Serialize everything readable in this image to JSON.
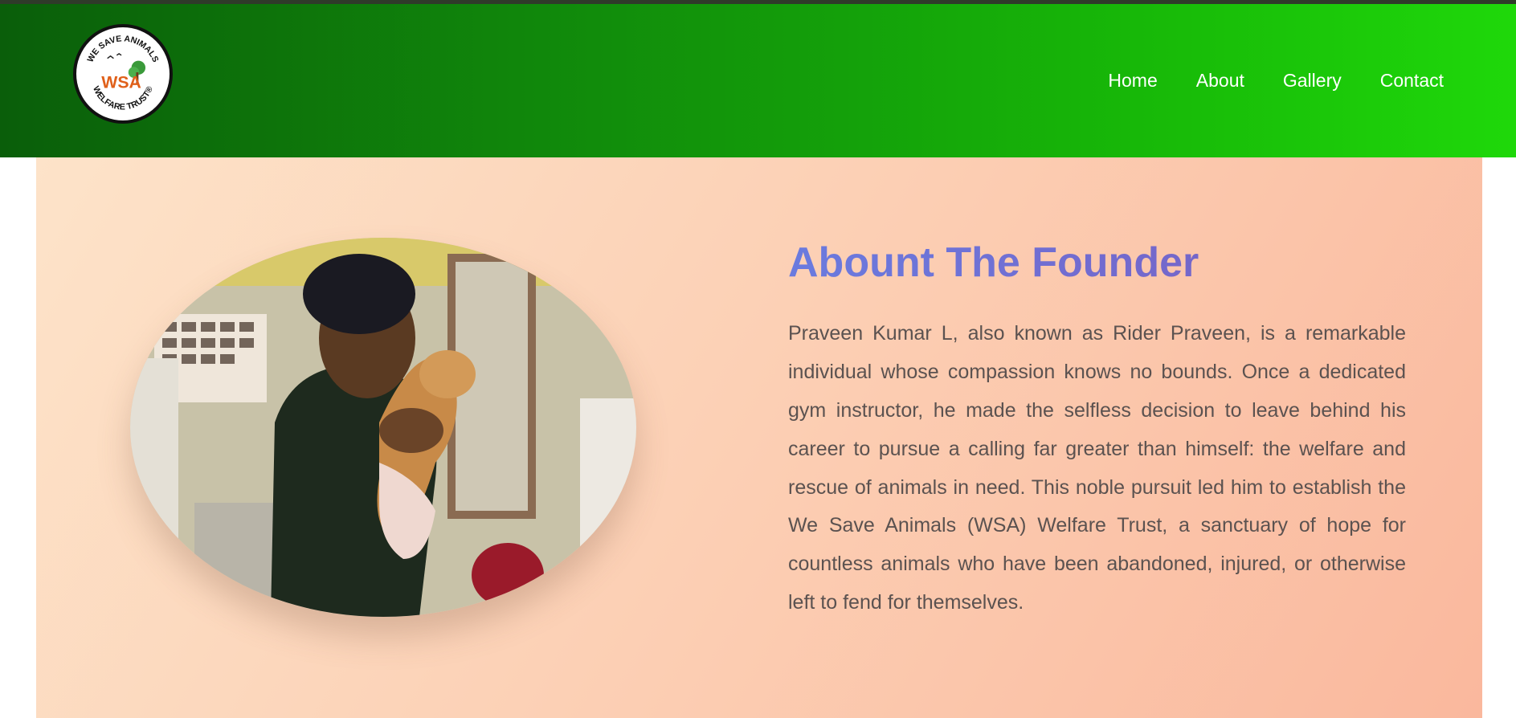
{
  "brand": {
    "logo_alt": "WSA Welfare Trust logo",
    "logo_text_top": "WE SAVE ANIMALS",
    "logo_text_mid": "WSA",
    "logo_text_bottom": "WELFARE TRUST®"
  },
  "nav": {
    "items": [
      {
        "label": "Home"
      },
      {
        "label": "About"
      },
      {
        "label": "Gallery"
      },
      {
        "label": "Contact"
      }
    ]
  },
  "founder": {
    "title": "Abount The Founder",
    "bio": "Praveen Kumar L, also known as Rider Praveen, is a remarkable individual whose compassion knows no bounds. Once a dedicated gym instructor, he made the selfless decision to leave behind his career to pursue a calling far greater than himself: the welfare and rescue of animals in need. This noble pursuit led him to establish the We Save Animals (WSA) Welfare Trust, a sanctuary of hope for countless animals who have been abandoned, injured, or otherwise left to fend for themselves.",
    "photo_alt": "Founder holding a puppy"
  },
  "colors": {
    "header_start": "#0a5e0a",
    "header_end": "#1fd80a",
    "hero_start": "#fde3c9",
    "hero_end": "#fab89d",
    "title_start": "#6a7bdf",
    "title_end": "#7a5cbf",
    "body_text": "#5b5250"
  }
}
